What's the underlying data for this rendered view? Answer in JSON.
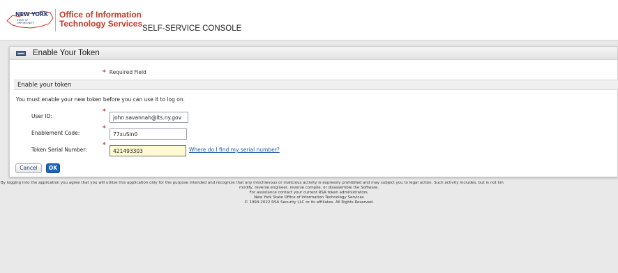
{
  "header": {
    "logo_ny": "NEW YORK",
    "logo_state_text": "STATE OF OPPORTUNITY",
    "office_name": "Office of Information Technology Services",
    "console_title": "SELF-SERVICE CONSOLE"
  },
  "card": {
    "title": "Enable Your Token",
    "required_note": "Required Field",
    "section_title": "Enable your token",
    "instructions": "You must enable your new token before you can use it to log on."
  },
  "form": {
    "user_id_label": "User ID:",
    "user_id_value": "john.savannah@its.ny.gov",
    "enablement_code_label": "Enablement Code:",
    "enablement_code_value": "77xuSin0",
    "serial_label": "Token Serial Number:",
    "serial_value": "421493303",
    "serial_help_link": "Where do I find my serial number?"
  },
  "buttons": {
    "cancel": "Cancel",
    "ok": "OK"
  },
  "footer": {
    "line1": "By logging into the application you agree that you will utilize this application only for the purpose intended and recognize that any mischievous or malicious activity is expressly prohibited and may subject you to legal action. Such activity includes, but is not lim",
    "line2": "modify, reverse engineer, reverse compile, or disassemble the Software.",
    "line3": "For assistance contact your current RSA token administrators.",
    "line4": "New York State Office of Information Technology Services",
    "line5": "© 1994-2022 RSA Security LLC or its affiliates. All Rights Reserved."
  },
  "colors": {
    "accent_red": "#c0392b",
    "primary_blue": "#1f63b8",
    "link_blue": "#1f5aa8",
    "active_input": "#fffbd0"
  }
}
